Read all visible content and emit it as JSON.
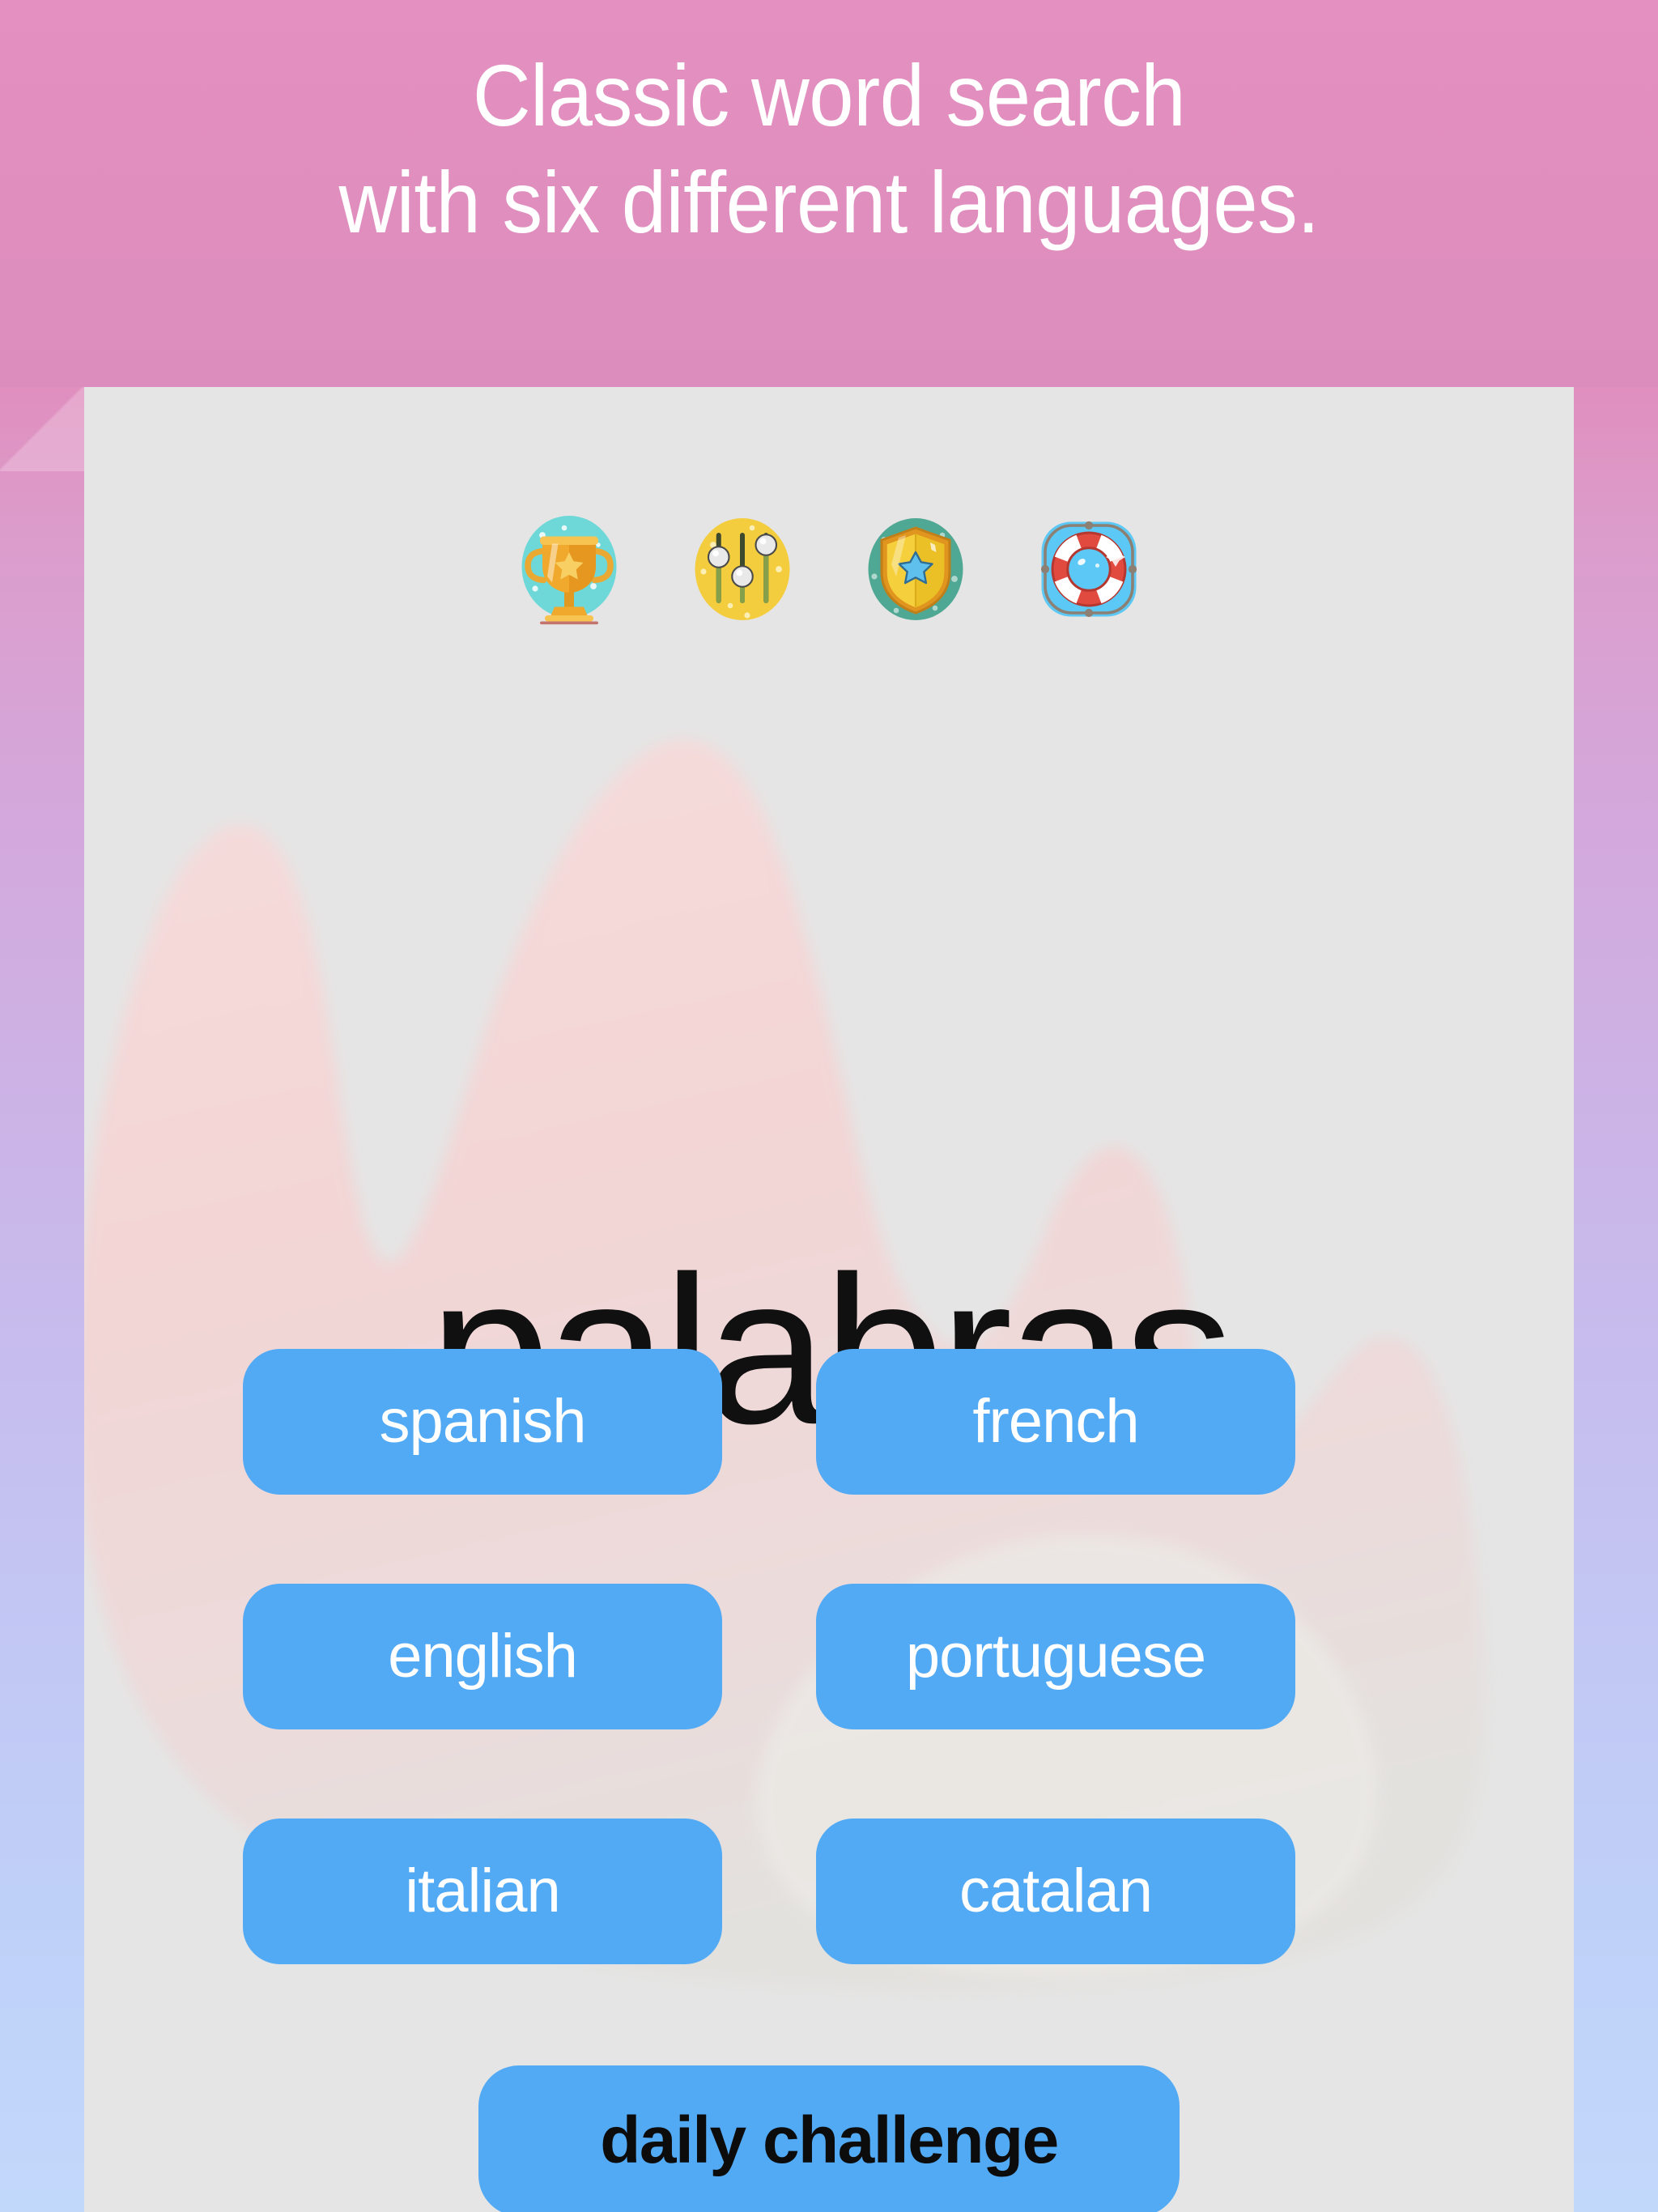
{
  "header": {
    "line1": "Classic word search",
    "line2": "with six different languages.",
    "background_color": "#e08fbf",
    "text_color": "#ffffff"
  },
  "app": {
    "panel_background": "#e5e5e5",
    "wash_color": "#f4d9d9",
    "wordmark": "palabras",
    "wordmark_color": "#101010",
    "toolbar": {
      "icons": [
        {
          "name": "trophy-icon",
          "label": "achievements",
          "circle_color": "#6ed8d8"
        },
        {
          "name": "sliders-icon",
          "label": "settings",
          "circle_color": "#f3cd3e"
        },
        {
          "name": "shield-icon",
          "label": "badges",
          "circle_color": "#4fa893"
        },
        {
          "name": "lifesaver-icon",
          "label": "help",
          "circle_color": "#5bc8f5"
        }
      ]
    },
    "languages": [
      {
        "id": "spanish",
        "label": "spanish"
      },
      {
        "id": "french",
        "label": "french"
      },
      {
        "id": "english",
        "label": "english"
      },
      {
        "id": "portuguese",
        "label": "portuguese"
      },
      {
        "id": "italian",
        "label": "italian"
      },
      {
        "id": "catalan",
        "label": "catalan"
      }
    ],
    "daily_challenge": {
      "label": "daily challenge",
      "button_color": "#52aaf5",
      "text_color": "#0c0c0c"
    },
    "button_color": "#52aaf5",
    "button_text_color": "#ffffff"
  }
}
